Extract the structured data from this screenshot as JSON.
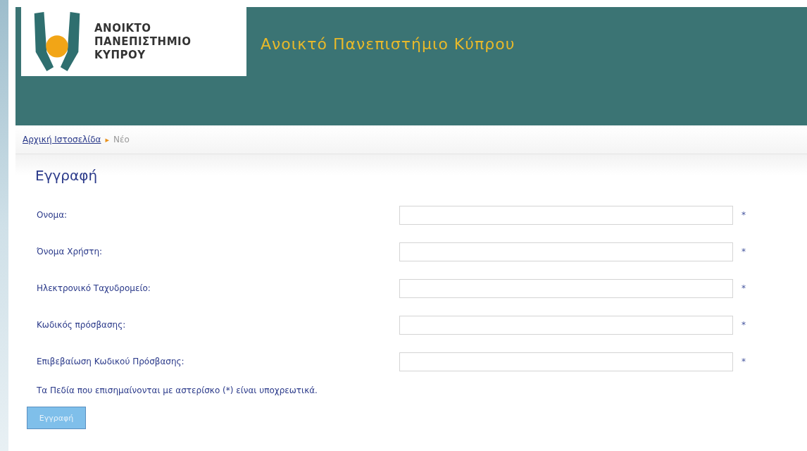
{
  "header": {
    "logo_lines": [
      "ΑΝΟΙΚΤΟ",
      "ΠΑΝΕΠΙΣΤΗΜΙΟ",
      "ΚΥΠΡΟΥ"
    ],
    "title": "Ανοικτό Πανεπιστήμιο Κύπρου"
  },
  "breadcrumb": {
    "items": [
      {
        "label": "Αρχική Ιστοσελίδα",
        "kind": "link"
      },
      {
        "label": "Νέο",
        "kind": "current"
      }
    ],
    "separator": "▸"
  },
  "form": {
    "heading": "Εγγραφή",
    "fields": [
      {
        "label": "Ονομα:",
        "required_mark": "*"
      },
      {
        "label": "Όνομα Χρήστη:",
        "required_mark": "*"
      },
      {
        "label": "Ηλεκτρονικό Ταχυδρομείο:",
        "required_mark": "*"
      },
      {
        "label": "Κωδικός πρόσβασης:",
        "required_mark": "*"
      },
      {
        "label": "Επιβεβαίωση Κωδικού Πρόσβασης:",
        "required_mark": "*"
      }
    ],
    "note": "Τα Πεδία που επισημαίνονται με αστερίσκο (*) είναι υποχρεωτικά.",
    "submit": "Εγγραφή"
  }
}
